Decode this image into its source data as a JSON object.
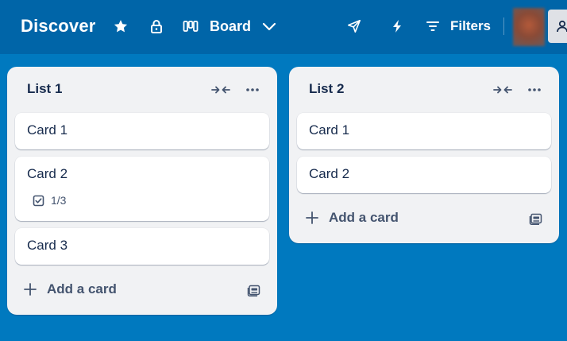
{
  "header": {
    "board_title": "Discover",
    "view_label": "Board",
    "filters_label": "Filters",
    "icons": {
      "star": "star-icon",
      "lock": "lock-icon",
      "view": "board-view-icon",
      "view_menu": "chevron-down-icon",
      "power_ups": "rocket-icon",
      "automation": "lightning-icon",
      "filters": "filter-icon",
      "share": "person-icon"
    }
  },
  "lists": [
    {
      "title": "List 1",
      "cards": [
        {
          "title": "Card 1"
        },
        {
          "title": "Card 2",
          "checklist": "1/3"
        },
        {
          "title": "Card 3"
        }
      ],
      "add_card_label": "Add a card"
    },
    {
      "title": "List 2",
      "cards": [
        {
          "title": "Card 1"
        },
        {
          "title": "Card 2"
        }
      ],
      "add_card_label": "Add a card"
    }
  ],
  "colors": {
    "board_background": "#0079bf",
    "header_background": "#0065a8",
    "list_background": "#f1f2f4",
    "card_background": "#ffffff",
    "text_primary": "#172b4d",
    "text_secondary": "#44546f"
  }
}
